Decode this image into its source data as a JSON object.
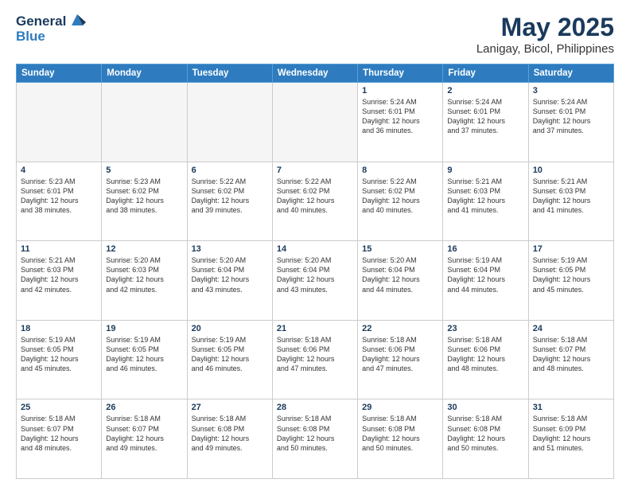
{
  "header": {
    "logo_line1": "General",
    "logo_line2": "Blue",
    "title": "May 2025",
    "subtitle": "Lanigay, Bicol, Philippines"
  },
  "weekdays": [
    "Sunday",
    "Monday",
    "Tuesday",
    "Wednesday",
    "Thursday",
    "Friday",
    "Saturday"
  ],
  "weeks": [
    [
      {
        "day": "",
        "text": ""
      },
      {
        "day": "",
        "text": ""
      },
      {
        "day": "",
        "text": ""
      },
      {
        "day": "",
        "text": ""
      },
      {
        "day": "1",
        "text": "Sunrise: 5:24 AM\nSunset: 6:01 PM\nDaylight: 12 hours\nand 36 minutes."
      },
      {
        "day": "2",
        "text": "Sunrise: 5:24 AM\nSunset: 6:01 PM\nDaylight: 12 hours\nand 37 minutes."
      },
      {
        "day": "3",
        "text": "Sunrise: 5:24 AM\nSunset: 6:01 PM\nDaylight: 12 hours\nand 37 minutes."
      }
    ],
    [
      {
        "day": "4",
        "text": "Sunrise: 5:23 AM\nSunset: 6:01 PM\nDaylight: 12 hours\nand 38 minutes."
      },
      {
        "day": "5",
        "text": "Sunrise: 5:23 AM\nSunset: 6:02 PM\nDaylight: 12 hours\nand 38 minutes."
      },
      {
        "day": "6",
        "text": "Sunrise: 5:22 AM\nSunset: 6:02 PM\nDaylight: 12 hours\nand 39 minutes."
      },
      {
        "day": "7",
        "text": "Sunrise: 5:22 AM\nSunset: 6:02 PM\nDaylight: 12 hours\nand 40 minutes."
      },
      {
        "day": "8",
        "text": "Sunrise: 5:22 AM\nSunset: 6:02 PM\nDaylight: 12 hours\nand 40 minutes."
      },
      {
        "day": "9",
        "text": "Sunrise: 5:21 AM\nSunset: 6:03 PM\nDaylight: 12 hours\nand 41 minutes."
      },
      {
        "day": "10",
        "text": "Sunrise: 5:21 AM\nSunset: 6:03 PM\nDaylight: 12 hours\nand 41 minutes."
      }
    ],
    [
      {
        "day": "11",
        "text": "Sunrise: 5:21 AM\nSunset: 6:03 PM\nDaylight: 12 hours\nand 42 minutes."
      },
      {
        "day": "12",
        "text": "Sunrise: 5:20 AM\nSunset: 6:03 PM\nDaylight: 12 hours\nand 42 minutes."
      },
      {
        "day": "13",
        "text": "Sunrise: 5:20 AM\nSunset: 6:04 PM\nDaylight: 12 hours\nand 43 minutes."
      },
      {
        "day": "14",
        "text": "Sunrise: 5:20 AM\nSunset: 6:04 PM\nDaylight: 12 hours\nand 43 minutes."
      },
      {
        "day": "15",
        "text": "Sunrise: 5:20 AM\nSunset: 6:04 PM\nDaylight: 12 hours\nand 44 minutes."
      },
      {
        "day": "16",
        "text": "Sunrise: 5:19 AM\nSunset: 6:04 PM\nDaylight: 12 hours\nand 44 minutes."
      },
      {
        "day": "17",
        "text": "Sunrise: 5:19 AM\nSunset: 6:05 PM\nDaylight: 12 hours\nand 45 minutes."
      }
    ],
    [
      {
        "day": "18",
        "text": "Sunrise: 5:19 AM\nSunset: 6:05 PM\nDaylight: 12 hours\nand 45 minutes."
      },
      {
        "day": "19",
        "text": "Sunrise: 5:19 AM\nSunset: 6:05 PM\nDaylight: 12 hours\nand 46 minutes."
      },
      {
        "day": "20",
        "text": "Sunrise: 5:19 AM\nSunset: 6:05 PM\nDaylight: 12 hours\nand 46 minutes."
      },
      {
        "day": "21",
        "text": "Sunrise: 5:18 AM\nSunset: 6:06 PM\nDaylight: 12 hours\nand 47 minutes."
      },
      {
        "day": "22",
        "text": "Sunrise: 5:18 AM\nSunset: 6:06 PM\nDaylight: 12 hours\nand 47 minutes."
      },
      {
        "day": "23",
        "text": "Sunrise: 5:18 AM\nSunset: 6:06 PM\nDaylight: 12 hours\nand 48 minutes."
      },
      {
        "day": "24",
        "text": "Sunrise: 5:18 AM\nSunset: 6:07 PM\nDaylight: 12 hours\nand 48 minutes."
      }
    ],
    [
      {
        "day": "25",
        "text": "Sunrise: 5:18 AM\nSunset: 6:07 PM\nDaylight: 12 hours\nand 48 minutes."
      },
      {
        "day": "26",
        "text": "Sunrise: 5:18 AM\nSunset: 6:07 PM\nDaylight: 12 hours\nand 49 minutes."
      },
      {
        "day": "27",
        "text": "Sunrise: 5:18 AM\nSunset: 6:08 PM\nDaylight: 12 hours\nand 49 minutes."
      },
      {
        "day": "28",
        "text": "Sunrise: 5:18 AM\nSunset: 6:08 PM\nDaylight: 12 hours\nand 50 minutes."
      },
      {
        "day": "29",
        "text": "Sunrise: 5:18 AM\nSunset: 6:08 PM\nDaylight: 12 hours\nand 50 minutes."
      },
      {
        "day": "30",
        "text": "Sunrise: 5:18 AM\nSunset: 6:08 PM\nDaylight: 12 hours\nand 50 minutes."
      },
      {
        "day": "31",
        "text": "Sunrise: 5:18 AM\nSunset: 6:09 PM\nDaylight: 12 hours\nand 51 minutes."
      }
    ]
  ]
}
